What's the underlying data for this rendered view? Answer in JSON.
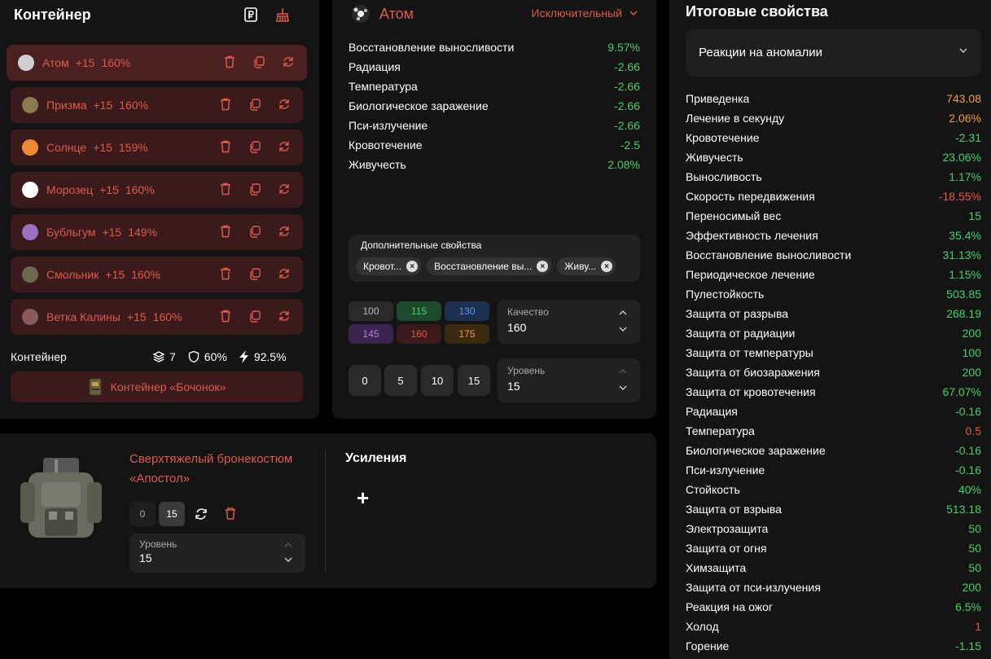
{
  "container": {
    "title": "Контейнер",
    "artifacts": [
      {
        "name": "Атом",
        "level": "+15",
        "pct": "160%",
        "color": "#cfcfcf"
      },
      {
        "name": "Призма",
        "level": "+15",
        "pct": "160%",
        "color": "#8a7a50"
      },
      {
        "name": "Солнце",
        "level": "+15",
        "pct": "159%",
        "color": "#f08a30"
      },
      {
        "name": "Морозец",
        "level": "+15",
        "pct": "160%",
        "color": "#ffffff"
      },
      {
        "name": "Бубльгум",
        "level": "+15",
        "pct": "149%",
        "color": "#9a70c0"
      },
      {
        "name": "Смольник",
        "level": "+15",
        "pct": "160%",
        "color": "#6a6a50"
      },
      {
        "name": "Ветка Калины",
        "level": "+15",
        "pct": "160%",
        "color": "#8a5a5a"
      }
    ],
    "footer_label": "Контейнер",
    "slots": "7",
    "protection": "60%",
    "efficiency": "92.5%",
    "container_name": "Контейнер «Бочонок»"
  },
  "detail": {
    "name": "Атом",
    "rarity": "Исключительный",
    "stats": [
      {
        "label": "Восстановление выносливости",
        "value": "9.57%",
        "color": "green"
      },
      {
        "label": "Радиация",
        "value": "-2.66",
        "color": "green"
      },
      {
        "label": "Температура",
        "value": "-2.66",
        "color": "green"
      },
      {
        "label": "Биологическое заражение",
        "value": "-2.66",
        "color": "green"
      },
      {
        "label": "Пси-излучение",
        "value": "-2.66",
        "color": "green"
      },
      {
        "label": "Кровотечение",
        "value": "-2.5",
        "color": "green"
      },
      {
        "label": "Живучесть",
        "value": "2.08%",
        "color": "green"
      }
    ],
    "extra_title": "Дополнительные свойства",
    "chips": [
      "Кровот...",
      "Восстановление вы...",
      "Живу..."
    ],
    "quality_buttons": [
      {
        "v": "100",
        "bg": "#2a2a2a",
        "fg": "#bbbbbb"
      },
      {
        "v": "115",
        "bg": "#1d4a2a",
        "fg": "#4fd070"
      },
      {
        "v": "130",
        "bg": "#1d3050",
        "fg": "#5a9ae0"
      },
      {
        "v": "145",
        "bg": "#3a2450",
        "fg": "#b080e0"
      },
      {
        "v": "160",
        "bg": "#3a1a1a",
        "fg": "#e05a4a"
      },
      {
        "v": "175",
        "bg": "#3a2a10",
        "fg": "#f0a030"
      }
    ],
    "quality_label": "Качество",
    "quality_value": "160",
    "level_buttons": [
      "0",
      "5",
      "10",
      "15"
    ],
    "level_label": "Уровень",
    "level_value": "15"
  },
  "armor": {
    "name_line1": "Сверхтяжелый бронекостюм",
    "name_line2": "«Апостол»",
    "btn_0": "0",
    "btn_15": "15",
    "level_label": "Уровень",
    "level_value": "15",
    "boost_title": "Усиления",
    "plus": "+"
  },
  "totals": {
    "title": "Итоговые свойства",
    "filter": "Реакции на аномалии",
    "rows": [
      {
        "label": "Приведенка",
        "value": "743.08",
        "color": "orange"
      },
      {
        "label": "Лечение в секунду",
        "value": "2.06%",
        "color": "orange"
      },
      {
        "label": "Кровотечение",
        "value": "-2.31",
        "color": "green"
      },
      {
        "label": "Живучесть",
        "value": "23.06%",
        "color": "green"
      },
      {
        "label": "Выносливость",
        "value": "1.17%",
        "color": "green"
      },
      {
        "label": "Скорость передвижения",
        "value": "-18.55%",
        "color": "red"
      },
      {
        "label": "Переносимый вес",
        "value": "15",
        "color": "green"
      },
      {
        "label": "Эффективность лечения",
        "value": "35.4%",
        "color": "green"
      },
      {
        "label": "Восстановление выносливости",
        "value": "31.13%",
        "color": "green"
      },
      {
        "label": "Периодическое лечение",
        "value": "1.15%",
        "color": "green"
      },
      {
        "label": "Пулестойкость",
        "value": "503.85",
        "color": "green"
      },
      {
        "label": "Защита от разрыва",
        "value": "268.19",
        "color": "green"
      },
      {
        "label": "Защита от радиации",
        "value": "200",
        "color": "green"
      },
      {
        "label": "Защита от температуры",
        "value": "100",
        "color": "green"
      },
      {
        "label": "Защита от биозаражения",
        "value": "200",
        "color": "green"
      },
      {
        "label": "Защита от кровотечения",
        "value": "67.07%",
        "color": "green"
      },
      {
        "label": "Радиация",
        "value": "-0.16",
        "color": "green"
      },
      {
        "label": "Температура",
        "value": "0.5",
        "color": "red"
      },
      {
        "label": "Биологическое заражение",
        "value": "-0.16",
        "color": "green"
      },
      {
        "label": "Пси-излучение",
        "value": "-0.16",
        "color": "green"
      },
      {
        "label": "Стойкость",
        "value": "40%",
        "color": "green"
      },
      {
        "label": "Защита от взрыва",
        "value": "513.18",
        "color": "green"
      },
      {
        "label": "Электрозащита",
        "value": "50",
        "color": "green"
      },
      {
        "label": "Защита от огня",
        "value": "50",
        "color": "green"
      },
      {
        "label": "Химзащита",
        "value": "50",
        "color": "green"
      },
      {
        "label": "Защита от пси-излучения",
        "value": "200",
        "color": "green"
      },
      {
        "label": "Реакция на ожог",
        "value": "6.5%",
        "color": "green"
      },
      {
        "label": "Холод",
        "value": "1",
        "color": "red"
      },
      {
        "label": "Горение",
        "value": "-1.15",
        "color": "green"
      }
    ]
  }
}
